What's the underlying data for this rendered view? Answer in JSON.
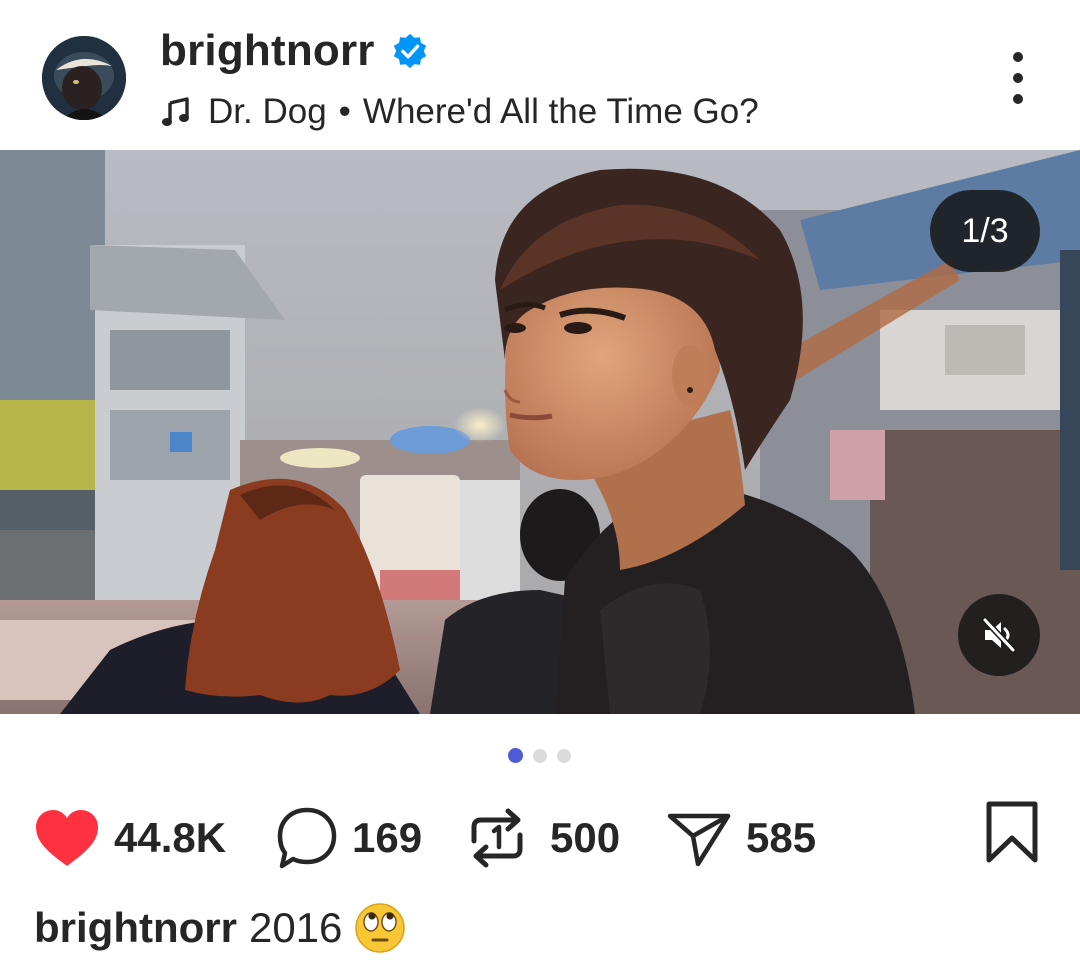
{
  "header": {
    "username": "brightnorr",
    "music_artist": "Dr. Dog",
    "music_separator": "•",
    "music_track": "Where'd All the Time Go?"
  },
  "media": {
    "page_counter": "1/3",
    "current_page": 1,
    "total_pages": 3
  },
  "actions": {
    "likes": "44.8K",
    "comments": "169",
    "reposts": "500",
    "shares": "585"
  },
  "caption": {
    "username": "brightnorr",
    "text": "2016"
  },
  "colors": {
    "like_heart": "#ff3040",
    "verified_badge": "#0095f6",
    "active_dot": "#4f5bd5",
    "inactive_dot": "#dbdbdb"
  },
  "icons": [
    "verified-badge-icon",
    "music-note-icon",
    "more-options-icon",
    "mute-icon",
    "heart-icon",
    "comment-icon",
    "repost-icon",
    "share-icon",
    "bookmark-icon",
    "face-with-rolling-eyes-emoji"
  ]
}
